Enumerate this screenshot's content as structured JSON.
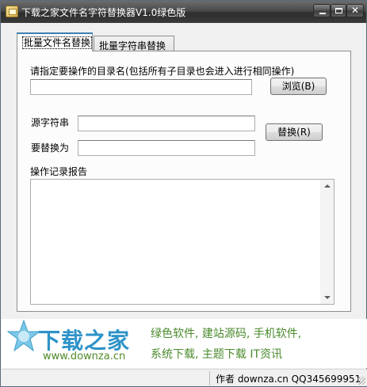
{
  "window": {
    "title": "下载之家文件名字符替换器V1.0绿色版",
    "controls": {
      "close_glyph": "✕"
    }
  },
  "tabs": [
    {
      "label": "批量文件名替换",
      "active": true
    },
    {
      "label": "批量字符串替换",
      "active": false
    }
  ],
  "form": {
    "dir_prompt": "请指定要操作的目录名(包括所有子目录也会进入进行相同操作)",
    "dir_value": "",
    "browse_label": "浏览(B)",
    "source_label": "源字符串",
    "source_value": "",
    "replace_label": "要替换为",
    "replace_value": "",
    "replace_button": "替换(R)",
    "log_label": "操作记录报告",
    "log_value": ""
  },
  "banner": {
    "brand": "下载之家",
    "url": "www.downza.cn",
    "line1": "绿色软件, 建站源码, 手机软件,",
    "line2": "系统下载, 主题下载 IT资讯"
  },
  "status": {
    "text": "作者 downza.cn  QQ345699951"
  },
  "colors": {
    "accent": "#3c7fb1",
    "brand_blue": "#2e93c8",
    "ad_green": "#4a8a2c"
  }
}
